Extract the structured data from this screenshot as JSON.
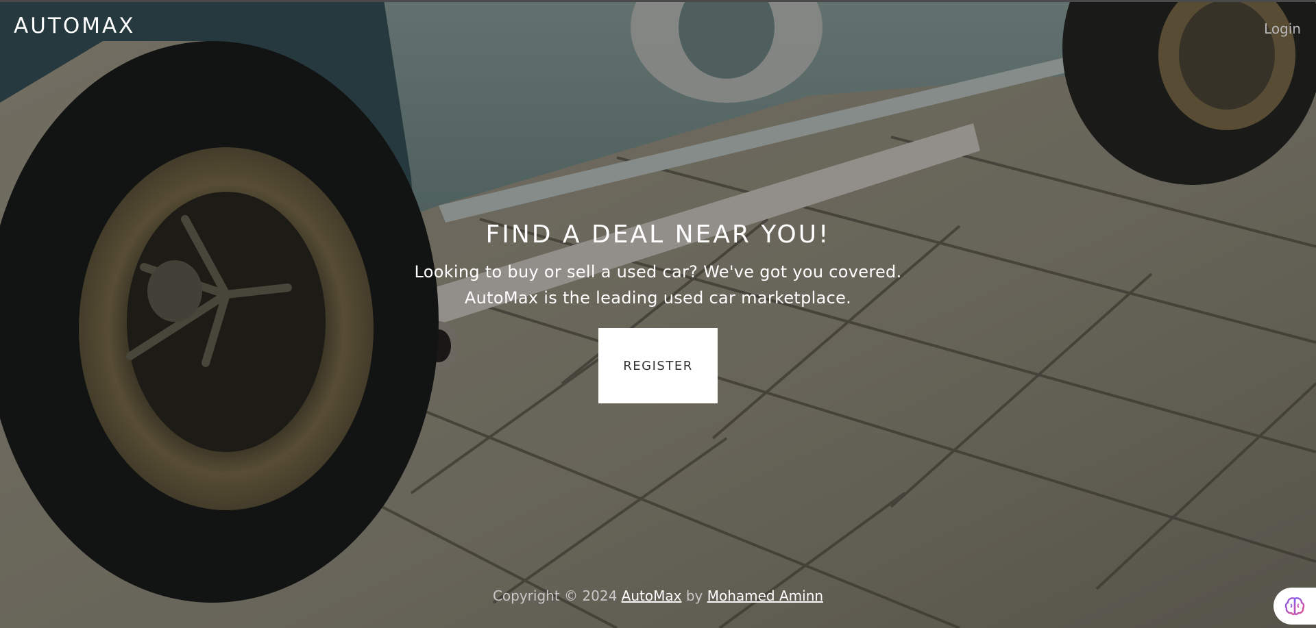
{
  "header": {
    "brand": "AUTOMAX",
    "login_label": "Login"
  },
  "hero": {
    "headline": "FIND A DEAL NEAR YOU!",
    "tagline_line1": "Looking to buy or sell a used car? We've got you covered.",
    "tagline_line2": "AutoMax is the leading used car marketplace.",
    "register_label": "REGISTER"
  },
  "footer": {
    "copyright_prefix": "Copyright © 2024",
    "site_link": "AutoMax",
    "by_text": "by",
    "author_link": "Mohamed Aminn"
  },
  "assistant": {
    "icon": "brain-icon"
  },
  "colors": {
    "overlay": "#000000",
    "button_bg": "#ffffff",
    "text": "#ffffff"
  }
}
